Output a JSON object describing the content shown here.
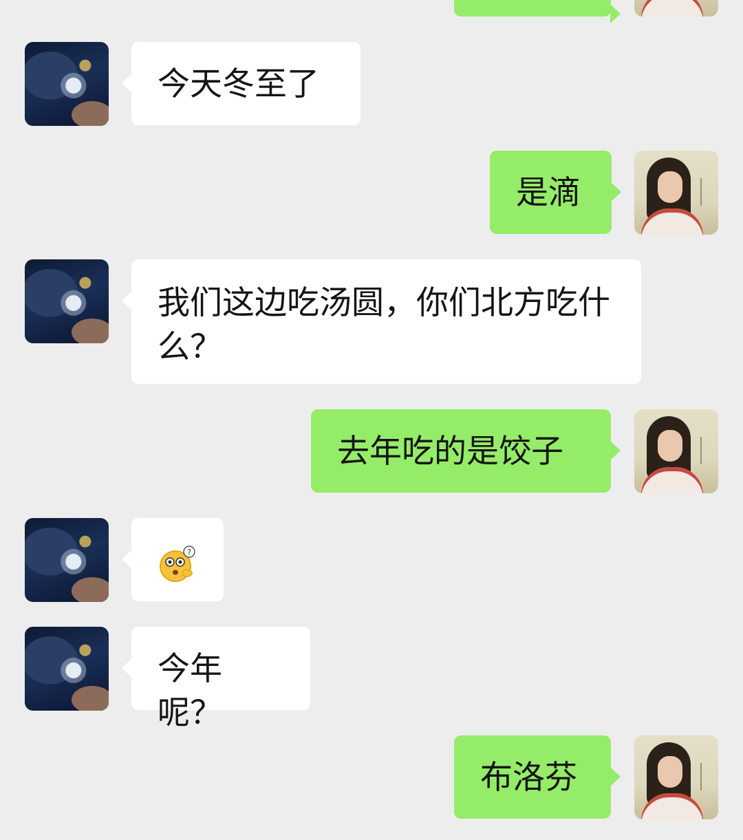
{
  "messages": [
    {
      "side": "them",
      "text": "今天冬至了"
    },
    {
      "side": "me",
      "text": "是滴"
    },
    {
      "side": "them",
      "text": "我们这边吃汤圆，你们北方吃什么？"
    },
    {
      "side": "me",
      "text": "去年吃的是饺子"
    },
    {
      "side": "them",
      "emoji": "confused-face-emoji"
    },
    {
      "side": "them",
      "text": "今年呢？"
    },
    {
      "side": "me",
      "text": "布洛芬"
    }
  ],
  "colors": {
    "background": "#ededed",
    "my_bubble": "#95ec69",
    "their_bubble": "#ffffff"
  }
}
